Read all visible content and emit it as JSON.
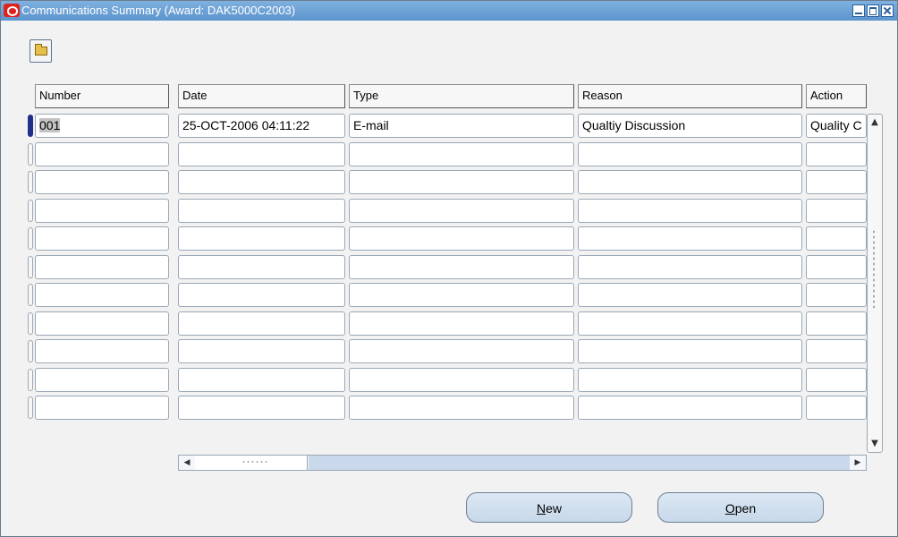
{
  "window": {
    "title": "Communications Summary (Award: DAK5000C2003)"
  },
  "toolbar": {
    "open_folder_icon": "folder-open-icon"
  },
  "table": {
    "columns": [
      "Number",
      "Date",
      "Type",
      "Reason",
      "Action"
    ],
    "rows": [
      [
        "001",
        "25-OCT-2006 04:11:22",
        "E-mail",
        "Qualtiy Discussion",
        "Quality C"
      ],
      [
        "",
        "",
        "",
        "",
        ""
      ],
      [
        "",
        "",
        "",
        "",
        ""
      ],
      [
        "",
        "",
        "",
        "",
        ""
      ],
      [
        "",
        "",
        "",
        "",
        ""
      ],
      [
        "",
        "",
        "",
        "",
        ""
      ],
      [
        "",
        "",
        "",
        "",
        ""
      ],
      [
        "",
        "",
        "",
        "",
        ""
      ],
      [
        "",
        "",
        "",
        "",
        ""
      ],
      [
        "",
        "",
        "",
        "",
        ""
      ],
      [
        "",
        "",
        "",
        "",
        ""
      ]
    ]
  },
  "buttons": {
    "new_label": "New",
    "new_mnemonic": "N",
    "new_rest": "ew",
    "open_label": "Open",
    "open_mnemonic": "O",
    "open_rest": "pen"
  },
  "colors": {
    "titlebar": "#6aa0d6",
    "active_row_indicator": "#1e2f8c",
    "button_fill": "#d2e1f0"
  }
}
